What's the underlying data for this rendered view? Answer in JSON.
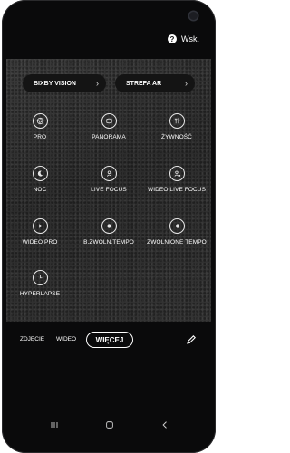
{
  "help": {
    "label": "Wsk."
  },
  "top_buttons": [
    {
      "label": "BIXBY VISION"
    },
    {
      "label": "STREFA AR"
    }
  ],
  "modes": [
    {
      "label": "PRO",
      "icon": "aperture-icon"
    },
    {
      "label": "PANORAMA",
      "icon": "panorama-icon"
    },
    {
      "label": "ŻYWNOŚĆ",
      "icon": "food-icon"
    },
    {
      "label": "NOC",
      "icon": "moon-icon"
    },
    {
      "label": "LIVE FOCUS",
      "icon": "person-icon"
    },
    {
      "label": "WIDEO LIVE FOCUS",
      "icon": "person-video-icon"
    },
    {
      "label": "WIDEO PRO",
      "icon": "play-icon"
    },
    {
      "label": "B.ZWOLN.TEMPO",
      "icon": "slow-motion-icon"
    },
    {
      "label": "ZWOLNIONE TEMPO",
      "icon": "slow-motion-video-icon"
    },
    {
      "label": "HYPERLAPSE",
      "icon": "clock-icon"
    }
  ],
  "tabs": {
    "photo": "ZDJĘCIE",
    "video": "WIDEO",
    "more": "WIĘCEJ"
  },
  "colors": {
    "background": "#0a0a0b",
    "panel": "#333333",
    "text": "#ffffff"
  }
}
